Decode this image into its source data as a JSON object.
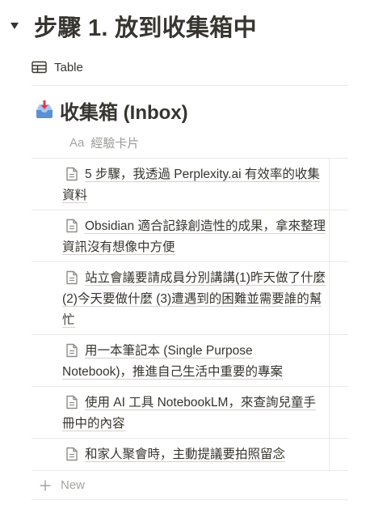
{
  "heading": {
    "title": "步驟 1. 放到收集箱中"
  },
  "view": {
    "tab_label": "Table"
  },
  "database": {
    "title": "收集箱 (Inbox)",
    "column_name": "經驗卡片",
    "column_type_glyph": "Aa"
  },
  "rows": [
    {
      "title": "5 步驟，我透過 Perplexity.ai 有效率的收集資料"
    },
    {
      "title": "Obsidian 適合記錄創造性的成果，拿來整理資訊沒有想像中方便"
    },
    {
      "title": "站立會議要請成員分別講講(1)昨天做了什麼 (2)今天要做什麼 (3)遭遇到的困難並需要誰的幫忙"
    },
    {
      "title": "用一本筆記本 (Single Purpose Notebook)，推進自己生活中重要的專案"
    },
    {
      "title": "使用 AI 工具 NotebookLM，來查詢兒童手冊中的內容"
    },
    {
      "title": "和家人聚會時，主動提議要拍照留念"
    }
  ],
  "new_row": {
    "label": "New"
  }
}
